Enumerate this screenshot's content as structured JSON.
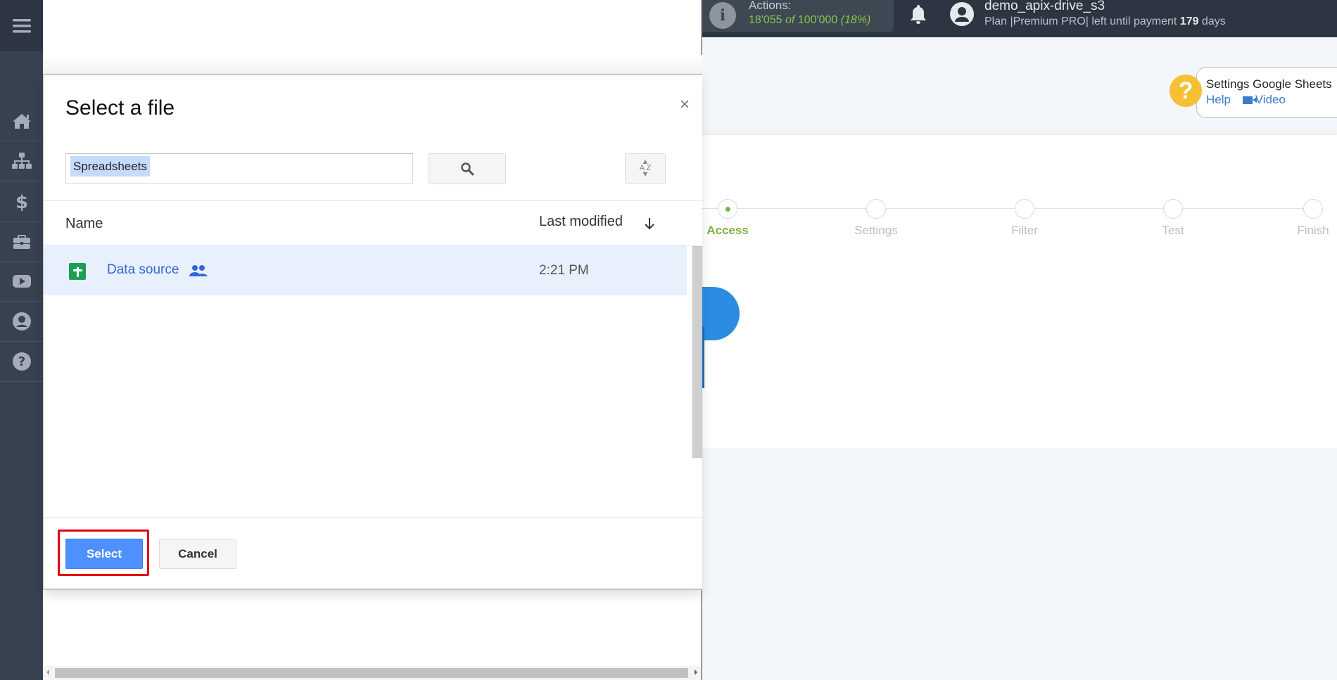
{
  "sidebar": {
    "menu_icon": "hamburger-icon",
    "items": [
      {
        "name": "home",
        "icon": "home-icon"
      },
      {
        "name": "connections",
        "icon": "sitemap-icon"
      },
      {
        "name": "billing",
        "icon": "dollar-icon"
      },
      {
        "name": "services",
        "icon": "briefcase-icon"
      },
      {
        "name": "video",
        "icon": "youtube-icon"
      },
      {
        "name": "profile",
        "icon": "user-circle-icon"
      },
      {
        "name": "help",
        "icon": "question-circle-icon"
      }
    ]
  },
  "header": {
    "actions_label": "Actions:",
    "actions_used": "18'055",
    "actions_of": "of",
    "actions_total": "100'000",
    "actions_percent": "(18%)",
    "username": "demo_apix-drive_s3",
    "plan_prefix": "Plan |Premium PRO| left until payment",
    "plan_days": "179",
    "plan_suffix": "days"
  },
  "help": {
    "title": "Settings Google Sheets",
    "help_link": "Help",
    "video_link": "Video"
  },
  "steps": [
    {
      "label": "Access",
      "active": true
    },
    {
      "label": "Settings",
      "active": false
    },
    {
      "label": "Filter",
      "active": false
    },
    {
      "label": "Test",
      "active": false
    },
    {
      "label": "Finish",
      "active": false
    }
  ],
  "dialog": {
    "title": "Select a file",
    "close_label": "×",
    "search_value": "Spreadsheets",
    "sort_label_top": "A",
    "sort_label_bottom": "Z",
    "columns": {
      "name": "Name",
      "last_modified": "Last modified"
    },
    "files": [
      {
        "name": "Data source",
        "type": "google-sheet",
        "shared": true,
        "modified": "2:21 PM",
        "selected": true
      }
    ],
    "select_label": "Select",
    "cancel_label": "Cancel"
  },
  "colors": {
    "accent_green": "#7cb342",
    "select_blue": "#4d90fe",
    "highlight_red": "#e3000f",
    "sidebar_bg": "#37414f",
    "header_bg": "#2c3541"
  }
}
